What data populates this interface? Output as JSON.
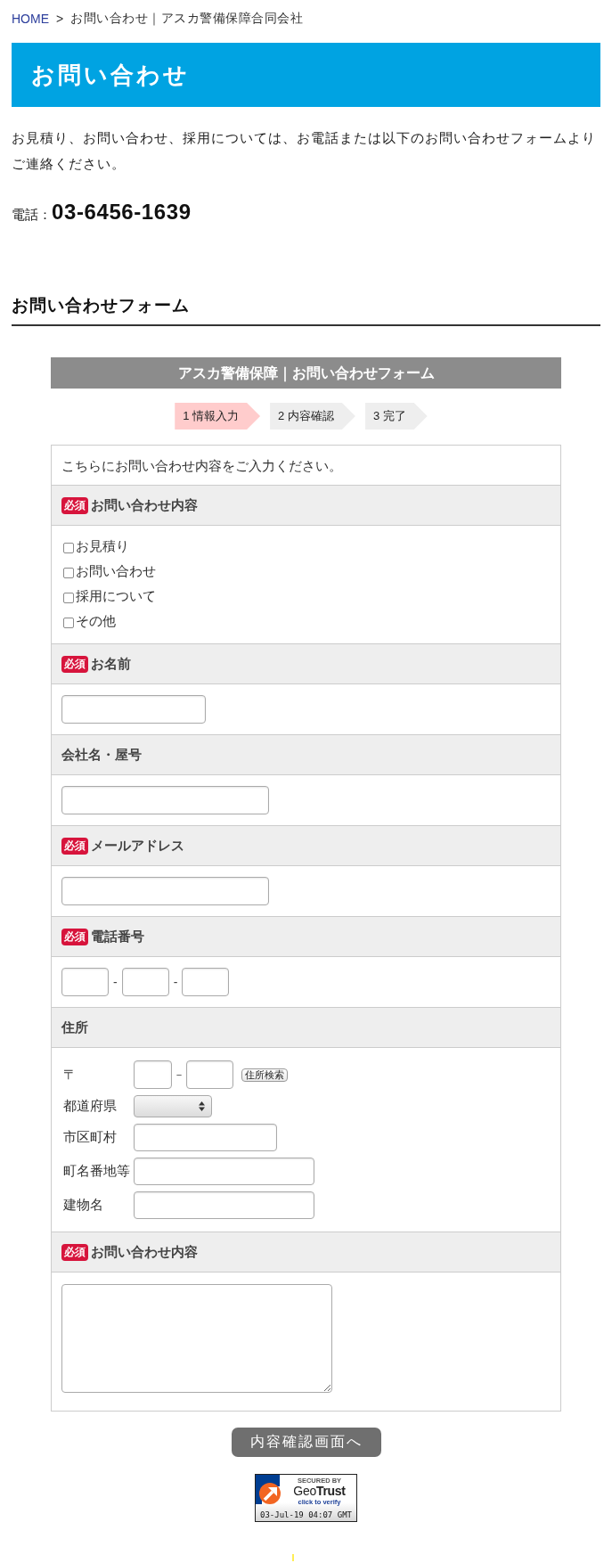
{
  "breadcrumb": [
    {
      "label": "HOME",
      "kind": "link"
    },
    {
      "label": ">",
      "kind": "separator"
    },
    {
      "label": "お問い合わせ｜アスカ警備保障合同会社",
      "kind": "current"
    }
  ],
  "page_title": "お問い合わせ",
  "intro": "お見積り、お問い合わせ、採用については、お電話または以下のお問い合わせフォームよりご連絡ください。",
  "phone": {
    "label": "電話：",
    "number": "03-6456-1639"
  },
  "section_title": "お問い合わせフォーム",
  "form": {
    "title": "アスカ警備保障｜お問い合わせフォーム",
    "steps": [
      {
        "label": "1 情報入力",
        "selected": true
      },
      {
        "label": "2 内容確認",
        "selected": false
      },
      {
        "label": "3 完了",
        "selected": false
      }
    ],
    "instruction": "こちらにお問い合わせ内容をご入力ください。",
    "fields": [
      {
        "label": "お問い合わせ内容",
        "badge": "必須",
        "kind": "checkgroup",
        "options": [
          {
            "label": "お見積り",
            "checked": false
          },
          {
            "label": "お問い合わせ",
            "checked": false
          },
          {
            "label": "採用について",
            "checked": false
          },
          {
            "label": "その他",
            "checked": false
          }
        ]
      },
      {
        "label": "お名前",
        "badge": "必須",
        "kind": "shorttext"
      },
      {
        "label": "会社名・屋号",
        "kind": "text"
      },
      {
        "label": "メールアドレス",
        "badge": "必須",
        "kind": "text"
      },
      {
        "label": "電話番号",
        "badge": "必須",
        "kind": "phone",
        "separators": [
          "-",
          "-"
        ]
      },
      {
        "label": "住所",
        "kind": "address",
        "rows": [
          {
            "label": "〒",
            "kind": "postal",
            "separator": "－",
            "button": "住所検索"
          },
          {
            "label": "都道府県",
            "kind": "select"
          },
          {
            "label": "市区町村",
            "kind": "text"
          },
          {
            "label": "町名番地等",
            "kind": "wide"
          },
          {
            "label": "建物名",
            "kind": "wide"
          }
        ]
      },
      {
        "label": "お問い合わせ内容",
        "badge": "必須",
        "kind": "textarea"
      }
    ],
    "submit_button": "内容確認画面へ"
  },
  "seal": {
    "caption": "SECURED BY",
    "brand": "Geo**Trust**",
    "link": "click to verify",
    "date": "03-Jul-19 04:07 GMT"
  }
}
